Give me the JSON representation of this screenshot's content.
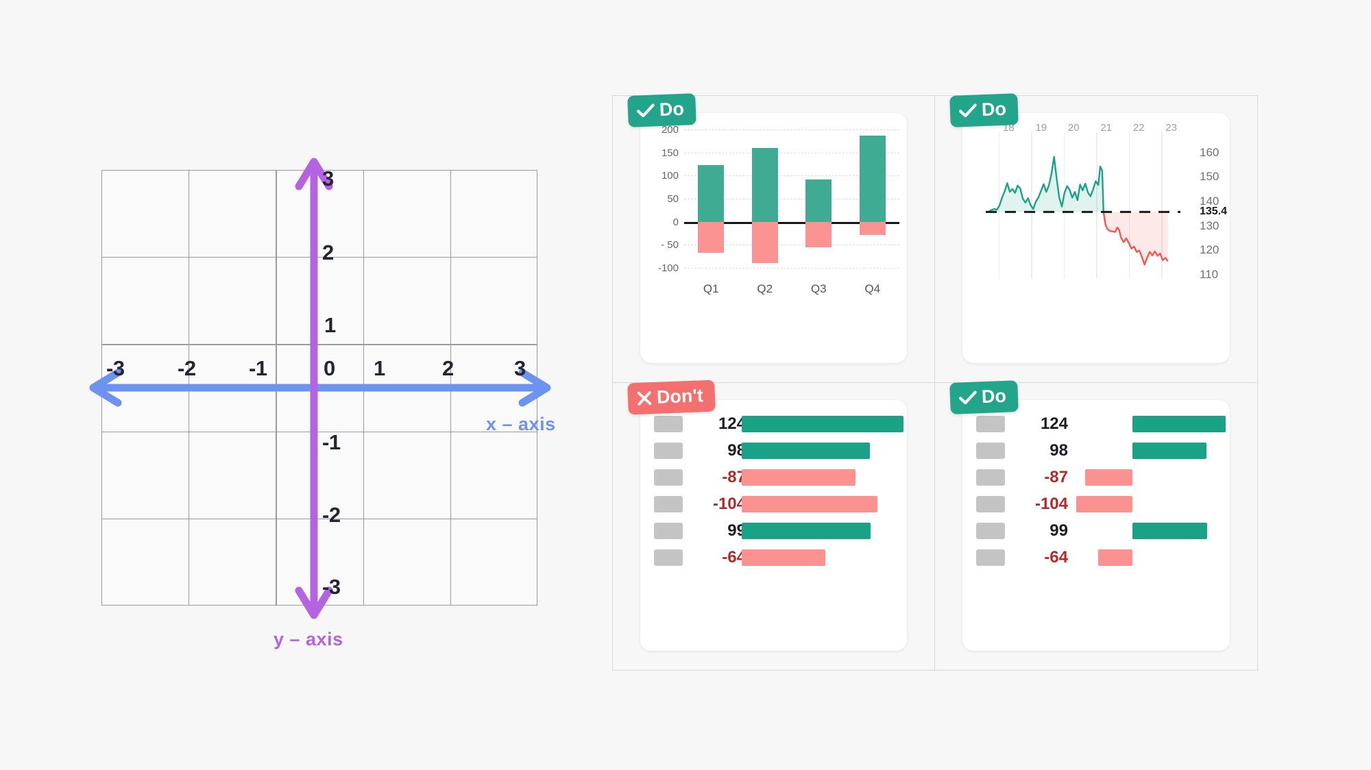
{
  "background_color": "#f7f7f7",
  "coordinate_plane": {
    "name": "cartesian-coordinate-plane",
    "x_axis": {
      "label": "x – axis",
      "color": "#6d93f0",
      "ticks": [
        "-3",
        "-2",
        "-1",
        "0",
        "1",
        "2",
        "3"
      ]
    },
    "y_axis": {
      "label": "y – axis",
      "color": "#b464e0",
      "ticks": [
        "3",
        "2",
        "1",
        "-1",
        "-2",
        "-3"
      ]
    },
    "origin_label": "0",
    "grid": {
      "columns": 5,
      "rows": 5,
      "line_color": "#9b9b9b"
    }
  },
  "panels": {
    "top_left": {
      "badge": {
        "text": "Do",
        "type": "do",
        "icon": "check-icon",
        "color": "#22a58a"
      }
    },
    "top_right": {
      "badge": {
        "text": "Do",
        "type": "do",
        "icon": "check-icon",
        "color": "#22a58a"
      }
    },
    "bottom_left": {
      "badge": {
        "text": "Don't",
        "type": "dont",
        "icon": "close-icon",
        "color": "#f4706e"
      }
    },
    "bottom_right": {
      "badge": {
        "text": "Do",
        "type": "do",
        "icon": "check-icon",
        "color": "#22a58a"
      }
    }
  },
  "chart_data": [
    {
      "id": "quarterly-bar-chart",
      "panel": "top_left",
      "type": "bar",
      "title": "",
      "xlabel": "",
      "ylabel": "",
      "categories": [
        "Q1",
        "Q2",
        "Q3",
        "Q4"
      ],
      "series": [
        {
          "name": "positive",
          "color": "#3fab93",
          "values": [
            123,
            160,
            92,
            187
          ]
        },
        {
          "name": "negative",
          "color": "#fa9392",
          "values": [
            -68,
            -90,
            -55,
            -28
          ]
        }
      ],
      "ytick_labels": [
        "200",
        "150",
        "100",
        "50",
        "0",
        "- 50",
        "-100"
      ],
      "ytick_values": [
        200,
        150,
        100,
        50,
        0,
        -50,
        -100
      ],
      "ylim": [
        -100,
        200
      ],
      "grid": true,
      "zero_baseline": 0,
      "zero_baseline_color": "#15151a",
      "legend": "none"
    },
    {
      "id": "price-area-line-chart",
      "panel": "top_right",
      "type": "area",
      "title": "",
      "xlabel": "",
      "ylabel": "",
      "xtick_labels": [
        "18",
        "19",
        "20",
        "21",
        "22",
        "23"
      ],
      "ytick_labels": [
        "160",
        "150",
        "140",
        "130",
        "120",
        "110"
      ],
      "ytick_values": [
        160,
        150,
        140,
        130,
        120,
        110
      ],
      "ylim": [
        108,
        163
      ],
      "xlim": [
        17.6,
        23.5
      ],
      "baseline_value": 135.4,
      "baseline_label": "135.4",
      "baseline_style": "dashed",
      "grid": true,
      "legend": "none",
      "series": [
        {
          "name": "above-baseline",
          "color": "#1aa287",
          "fill": "rgba(26,162,135,0.13)",
          "points": [
            [
              17.7,
              135.6
            ],
            [
              17.78,
              136.2
            ],
            [
              17.86,
              136.6
            ],
            [
              17.94,
              136.3
            ],
            [
              18.02,
              138.0
            ],
            [
              18.1,
              141.2
            ],
            [
              18.18,
              143.8
            ],
            [
              18.26,
              147.2
            ],
            [
              18.34,
              143.6
            ],
            [
              18.42,
              144.8
            ],
            [
              18.5,
              143.2
            ],
            [
              18.58,
              146.2
            ],
            [
              18.66,
              145.0
            ],
            [
              18.74,
              140.8
            ],
            [
              18.82,
              139.2
            ],
            [
              18.9,
              141.0
            ],
            [
              18.98,
              138.2
            ],
            [
              19.06,
              136.6
            ],
            [
              19.14,
              139.6
            ],
            [
              19.22,
              141.4
            ],
            [
              19.3,
              144.0
            ],
            [
              19.38,
              146.8
            ],
            [
              19.46,
              143.6
            ],
            [
              19.54,
              146.2
            ],
            [
              19.62,
              151.0
            ],
            [
              19.7,
              158.0
            ],
            [
              19.78,
              149.0
            ],
            [
              19.86,
              141.2
            ],
            [
              19.94,
              137.6
            ],
            [
              20.02,
              143.2
            ],
            [
              20.1,
              146.0
            ],
            [
              20.18,
              144.4
            ],
            [
              20.26,
              141.2
            ],
            [
              20.34,
              143.6
            ],
            [
              20.42,
              140.2
            ],
            [
              20.5,
              146.6
            ],
            [
              20.58,
              144.2
            ],
            [
              20.66,
              147.0
            ],
            [
              20.74,
              143.4
            ],
            [
              20.82,
              141.8
            ],
            [
              20.9,
              144.6
            ],
            [
              20.98,
              148.0
            ],
            [
              21.06,
              146.4
            ],
            [
              21.12,
              154.0
            ],
            [
              21.18,
              152.2
            ],
            [
              21.22,
              135.4
            ]
          ]
        },
        {
          "name": "below-baseline",
          "color": "#f0574f",
          "fill": "rgba(240,87,79,0.13)",
          "points": [
            [
              21.22,
              135.4
            ],
            [
              21.28,
              130.2
            ],
            [
              21.34,
              128.4
            ],
            [
              21.42,
              127.6
            ],
            [
              21.5,
              127.4
            ],
            [
              21.58,
              127.2
            ],
            [
              21.64,
              129.0
            ],
            [
              21.7,
              128.0
            ],
            [
              21.76,
              124.8
            ],
            [
              21.84,
              123.0
            ],
            [
              21.92,
              124.6
            ],
            [
              22.0,
              122.6
            ],
            [
              22.08,
              120.4
            ],
            [
              22.16,
              121.2
            ],
            [
              22.24,
              119.0
            ],
            [
              22.32,
              119.6
            ],
            [
              22.4,
              117.0
            ],
            [
              22.48,
              113.8
            ],
            [
              22.56,
              116.6
            ],
            [
              22.64,
              119.0
            ],
            [
              22.72,
              117.6
            ],
            [
              22.8,
              119.2
            ],
            [
              22.88,
              117.4
            ],
            [
              22.96,
              118.4
            ],
            [
              23.04,
              115.6
            ],
            [
              23.12,
              116.6
            ],
            [
              23.2,
              115.2
            ]
          ]
        }
      ]
    },
    {
      "id": "value-bars-misaligned",
      "panel": "bottom_left",
      "type": "bar",
      "orientation": "horizontal",
      "title": "",
      "note": "all bars share the same left origin regardless of sign",
      "categories": [
        "",
        "",
        "",
        "",
        "",
        ""
      ],
      "values": [
        124,
        98,
        -87,
        -104,
        99,
        -64
      ],
      "labels": [
        "124",
        "98",
        "-87",
        "-104",
        "99",
        "-64"
      ],
      "positive_color": "#1aa287",
      "negative_color": "#fb9190",
      "swatch_color": "#c4c4c4",
      "grid": false,
      "legend": "none"
    },
    {
      "id": "value-bars-diverging",
      "panel": "bottom_right",
      "type": "bar",
      "orientation": "horizontal",
      "note": "bars diverge from a shared zero baseline",
      "categories": [
        "",
        "",
        "",
        "",
        "",
        ""
      ],
      "values": [
        124,
        98,
        -87,
        -104,
        99,
        -64
      ],
      "labels": [
        "124",
        "98",
        "-87",
        "-104",
        "99",
        "-64"
      ],
      "positive_color": "#1aa287",
      "negative_color": "#fb9190",
      "swatch_color": "#c4c4c4",
      "grid": false,
      "legend": "none"
    }
  ]
}
